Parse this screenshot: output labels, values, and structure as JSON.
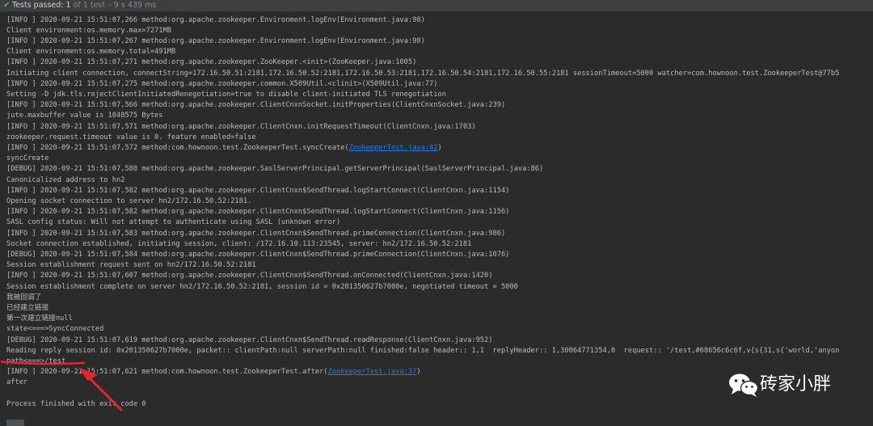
{
  "status": {
    "passed_label": "Tests passed:",
    "passed_count": "1",
    "of_total": "of 1 test",
    "duration": "– 9 s 439 ms"
  },
  "console": {
    "lines": [
      {
        "text": "[INFO ] 2020-09-21 15:51:07,266 method:org.apache.zookeeper.Environment.logEnv(Environment.java:98)"
      },
      {
        "text": "Client environment:os.memory.max=7271MB"
      },
      {
        "text": "[INFO ] 2020-09-21 15:51:07,267 method:org.apache.zookeeper.Environment.logEnv(Environment.java:98)"
      },
      {
        "text": "Client environment:os.memory.total=491MB"
      },
      {
        "text": "[INFO ] 2020-09-21 15:51:07,271 method:org.apache.zookeeper.ZooKeeper.<init>(ZooKeeper.java:1005)"
      },
      {
        "text": "Initiating client connection, connectString=172.16.50.51:2181,172.16.50.52:2181,172.16.50.53:2181,172.16.50.54:2181,172.16.50.55:2181 sessionTimeout=5000 watcher=com.hownoon.test.ZookeeperTest@77b5"
      },
      {
        "text": "[INFO ] 2020-09-21 15:51:07,275 method:org.apache.zookeeper.common.X509Util.<clinit>(X509Util.java:77)"
      },
      {
        "text": "Setting -D jdk.tls.rejectClientInitiatedRenegotiation=true to disable client-initiated TLS renegotiation"
      },
      {
        "text": "[INFO ] 2020-09-21 15:51:07,566 method:org.apache.zookeeper.ClientCnxnSocket.initProperties(ClientCnxnSocket.java:239)"
      },
      {
        "text": "jute.maxbuffer value is 1048575 Bytes"
      },
      {
        "text": "[INFO ] 2020-09-21 15:51:07,571 method:org.apache.zookeeper.ClientCnxn.initRequestTimeout(ClientCnxn.java:1703)"
      },
      {
        "text": "zookeeper.request.timeout value is 0. feature enabled=false"
      },
      {
        "pre": "[INFO ] 2020-09-21 15:51:07,572 method:com.hownoon.test.ZookeeperTest.syncCreate(",
        "link": "ZookeeperTest.java:42",
        "post": ")"
      },
      {
        "text": "syncCreate"
      },
      {
        "text": "[DEBUG] 2020-09-21 15:51:07,580 method:org.apache.zookeeper.SaslServerPrincipal.getServerPrincipal(SaslServerPrincipal.java:86)"
      },
      {
        "text": "Canonicalized address to hn2"
      },
      {
        "text": "[INFO ] 2020-09-21 15:51:07,582 method:org.apache.zookeeper.ClientCnxn$SendThread.logStartConnect(ClientCnxn.java:1154)"
      },
      {
        "text": "Opening socket connection to server hn2/172.16.50.52:2181."
      },
      {
        "text": "[INFO ] 2020-09-21 15:51:07,582 method:org.apache.zookeeper.ClientCnxn$SendThread.logStartConnect(ClientCnxn.java:1156)"
      },
      {
        "text": "SASL config status: Will not attempt to authenticate using SASL (unknown error)"
      },
      {
        "text": "[INFO ] 2020-09-21 15:51:07,583 method:org.apache.zookeeper.ClientCnxn$SendThread.primeConnection(ClientCnxn.java:986)"
      },
      {
        "text": "Socket connection established, initiating session, client: /172.16.10.113:23545, server: hn2/172.16.50.52:2181"
      },
      {
        "text": "[DEBUG] 2020-09-21 15:51:07,584 method:org.apache.zookeeper.ClientCnxn$SendThread.primeConnection(ClientCnxn.java:1076)"
      },
      {
        "text": "Session establishment request sent on hn2/172.16.50.52:2181"
      },
      {
        "text": "[INFO ] 2020-09-21 15:51:07,607 method:org.apache.zookeeper.ClientCnxn$SendThread.onConnected(ClientCnxn.java:1420)"
      },
      {
        "text": "Session establishment complete on server hn2/172.16.50.52:2181, session id = 0x201350627b7000e, negotiated timeout = 5000"
      },
      {
        "text": "我被回调了"
      },
      {
        "text": "已经建立链接"
      },
      {
        "text": "第一次建立链接null"
      },
      {
        "text": "state<===>SyncConnected"
      },
      {
        "text": "[DEBUG] 2020-09-21 15:51:07,619 method:org.apache.zookeeper.ClientCnxn$SendThread.readResponse(ClientCnxn.java:952)"
      },
      {
        "text": "Reading reply session id: 0x201350627b7000e, packet:: clientPath:null serverPath:null finished:false header:: 1,1  replyHeader:: 1,30064771354,0  request:: '/test,#68656c6c6f,v{s{31,s{'world,'anyon"
      },
      {
        "text": "path<===>/test"
      },
      {
        "pre": "[INFO ] 2020-09-21 15:51:07,621 method:com.hownoon.test.ZookeeperTest.after(",
        "link": "ZookeeperTest.java:37",
        "post": ")"
      },
      {
        "text": "after"
      },
      {
        "text": ""
      },
      {
        "text": "Process finished with exit code 0"
      }
    ]
  },
  "watermark": {
    "text": "砖家小胖",
    "icon": "wechat-icon"
  },
  "annotation": {
    "color": "#e8252c"
  },
  "colors": {
    "background": "#2b2b2b",
    "text": "#bbbbbb",
    "link": "#287bde",
    "success": "#59a869"
  }
}
